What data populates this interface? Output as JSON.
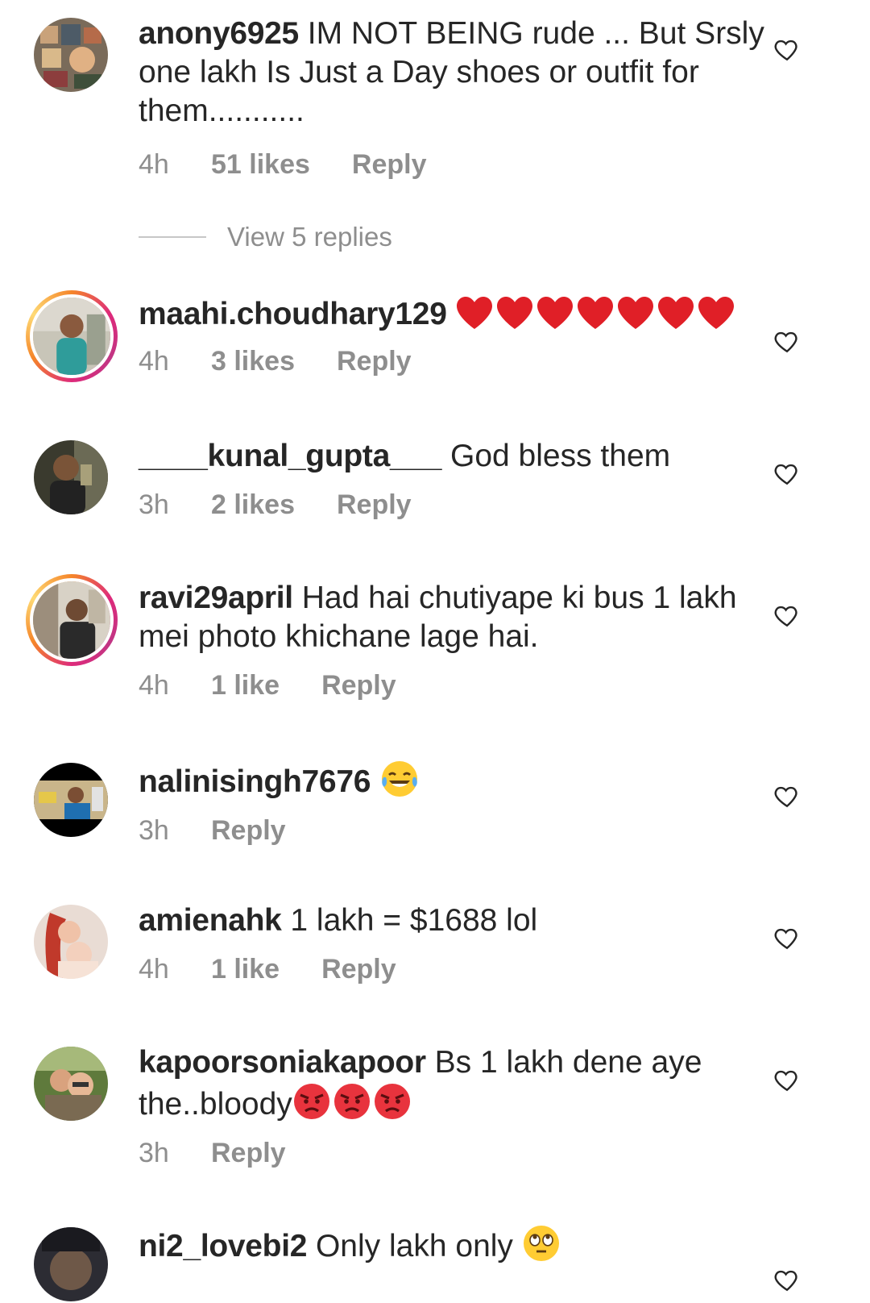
{
  "heart_color": "#262626",
  "comments": [
    {
      "username": "anony6925",
      "text": "IM NOT BEING rude ... But Srsly one lakh Is Just a Day shoes or outfit for them...........",
      "time": "4h",
      "likes": "51 likes",
      "reply": "Reply",
      "avatar_ring": false
    },
    {
      "username": "maahi.choudhary129",
      "text": "",
      "emoji": "red-heart-icon",
      "emoji_count": 7,
      "time": "4h",
      "likes": "3 likes",
      "reply": "Reply",
      "avatar_ring": true
    },
    {
      "username": "____kunal_gupta___",
      "text": "God bless them",
      "time": "3h",
      "likes": "2 likes",
      "reply": "Reply",
      "avatar_ring": false
    },
    {
      "username": "ravi29april",
      "text": "Had hai chutiyape ki bus 1 lakh mei photo khichane lage hai.",
      "time": "4h",
      "likes": "1 like",
      "reply": "Reply",
      "avatar_ring": true
    },
    {
      "username": "nalinisingh7676",
      "text": "",
      "emoji": "tears-of-joy-emoji-icon",
      "time": "3h",
      "likes": "",
      "reply": "Reply",
      "avatar_ring": false
    },
    {
      "username": "amienahk",
      "text": "1 lakh = $1688 lol",
      "time": "4h",
      "likes": "1 like",
      "reply": "Reply",
      "avatar_ring": false
    },
    {
      "username": "kapoorsoniakapoor",
      "text": "Bs 1 lakh dene aye the..bloody",
      "emoji": "angry-face-emoji-icon",
      "emoji_count": 3,
      "time": "3h",
      "likes": "",
      "reply": "Reply",
      "avatar_ring": false
    },
    {
      "username": "ni2_lovebi2",
      "text": "Only lakh only",
      "emoji": "eye-roll-emoji-icon",
      "time": "",
      "likes": "",
      "reply": "",
      "avatar_ring": false
    }
  ],
  "view_replies": "View 5 replies"
}
